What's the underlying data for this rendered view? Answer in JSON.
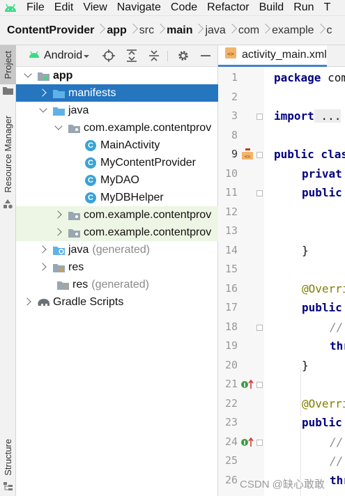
{
  "menubar": {
    "items": [
      "File",
      "Edit",
      "View",
      "Navigate",
      "Code",
      "Refactor",
      "Build",
      "Run",
      "T"
    ]
  },
  "breadcrumbs": [
    "ContentProvider",
    "app",
    "src",
    "main",
    "java",
    "com",
    "example",
    "c"
  ],
  "left_strip": {
    "project": "Project",
    "resource_manager": "Resource Manager",
    "structure": "Structure"
  },
  "project_panel": {
    "view_mode": "Android",
    "tree": [
      {
        "label": "app"
      },
      {
        "label": "manifests"
      },
      {
        "label": "java"
      },
      {
        "label": "com.example.contentprov"
      },
      {
        "label": "MainActivity"
      },
      {
        "label": "MyContentProvider"
      },
      {
        "label": "MyDAO"
      },
      {
        "label": "MyDBHelper"
      },
      {
        "label": "com.example.contentprov"
      },
      {
        "label": "com.example.contentprov"
      },
      {
        "label": "java",
        "suffix": "(generated)"
      },
      {
        "label": "res"
      },
      {
        "label": "res",
        "suffix": "(generated)"
      },
      {
        "label": "Gradle Scripts"
      }
    ]
  },
  "editor": {
    "tab_title": "activity_main.xml",
    "line_numbers": [
      "1",
      "2",
      "3",
      "8",
      "9",
      "10",
      "11",
      "12",
      "13",
      "14",
      "15",
      "16",
      "17",
      "18",
      "19",
      "20",
      "21",
      "22",
      "23",
      "24",
      "25",
      "26"
    ],
    "code": {
      "l1_kw": "package",
      "l1_rest": " com",
      "l3_kw": "import",
      "l3_rest": " ...",
      "l9_kw": "public",
      "l9_rest": " clas",
      "l10_kw": "privat",
      "l11_kw": "public",
      "l14": "}",
      "l16": "@Overri",
      "l17_kw": "public",
      "l18": "//",
      "l19_kw": "thr",
      "l20": "}",
      "l22": "@Overri",
      "l23_kw": "public",
      "l24": "//",
      "l25": "//",
      "l26_kw": "thr"
    }
  },
  "watermark": "CSDN @缺心敢敢",
  "colors": {
    "selection": "#2675bf",
    "module_green": "#edf6e4",
    "keyword": "#000080"
  }
}
